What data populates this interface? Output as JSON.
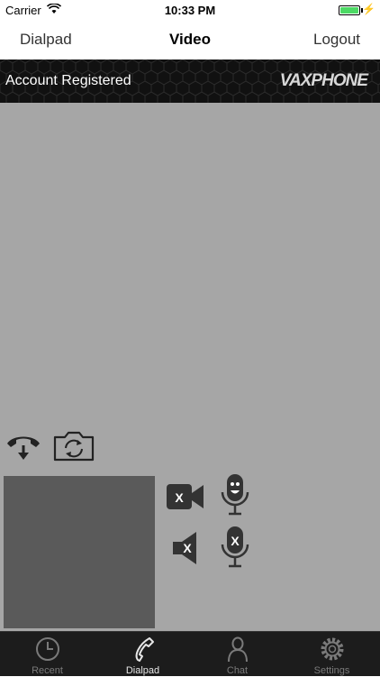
{
  "status_bar": {
    "carrier": "Carrier",
    "time": "10:33 PM"
  },
  "nav": {
    "left": "Dialpad",
    "title": "Video",
    "right": "Logout"
  },
  "banner": {
    "status": "Account Registered",
    "brand": "VAXPHONE"
  },
  "controls": {
    "hangup": "hang-up-icon",
    "switch_camera": "camera-switch-icon",
    "camera_off": "video-off-icon",
    "speaker_off": "speaker-mute-icon",
    "mic_on": "microphone-icon",
    "mic_off": "microphone-mute-icon"
  },
  "tabs": [
    {
      "label": "Recent",
      "icon": "clock-icon"
    },
    {
      "label": "Dialpad",
      "icon": "phone-icon",
      "active": true
    },
    {
      "label": "Chat",
      "icon": "person-icon"
    },
    {
      "label": "Settings",
      "icon": "gear-icon"
    }
  ],
  "colors": {
    "video_bg": "#a6a6a6",
    "preview_bg": "#5a5a5a",
    "battery": "#4cd964",
    "tab_bar": "#1c1c1c"
  }
}
